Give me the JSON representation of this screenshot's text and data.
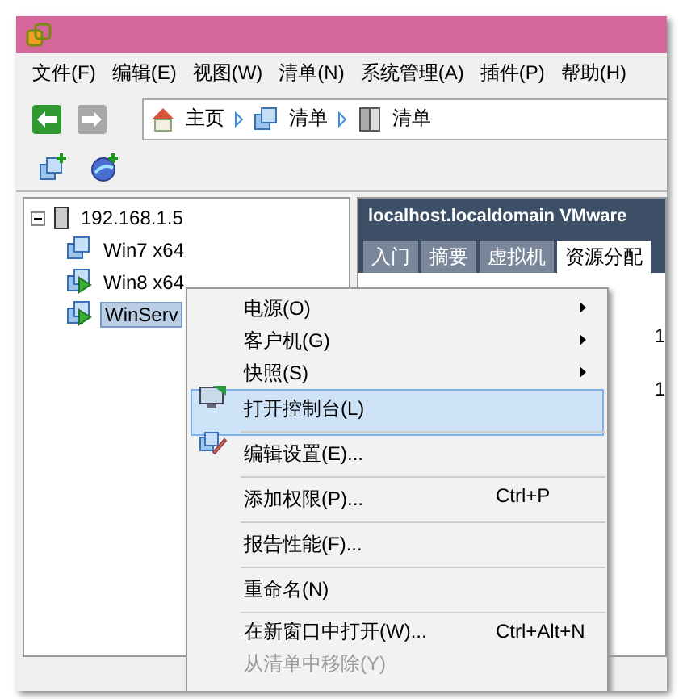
{
  "menu_bar": [
    "文件(F)",
    "编辑(E)",
    "视图(W)",
    "清单(N)",
    "系统管理(A)",
    "插件(P)",
    "帮助(H)"
  ],
  "navigation": {
    "back_disabled": false,
    "forward_disabled": true,
    "breadcrumbs": [
      "主页",
      "清单",
      "清单"
    ]
  },
  "tree": {
    "label": "192.168.1.5",
    "expanded": true,
    "children": [
      {
        "label": "Win7 x64",
        "powered_on": false,
        "selected": false
      },
      {
        "label": "Win8 x64",
        "powered_on": true,
        "selected": false
      },
      {
        "label": "WinServ",
        "powered_on": true,
        "selected": true
      }
    ]
  },
  "detail": {
    "title": "localhost.localdomain VMware",
    "tabs": [
      {
        "label": "入门",
        "selected": false
      },
      {
        "label": "摘要",
        "selected": false
      },
      {
        "label": "虚拟机",
        "selected": false
      },
      {
        "label": "资源分配",
        "selected": true
      }
    ],
    "values": [
      "1",
      "1"
    ]
  },
  "context_menu": [
    {
      "label": "电源(O)",
      "submenu": true,
      "selected": false,
      "disabled": false,
      "separator_after": false
    },
    {
      "label": "客户机(G)",
      "submenu": true,
      "selected": false,
      "disabled": false,
      "separator_after": false
    },
    {
      "label": "快照(S)",
      "submenu": true,
      "selected": false,
      "disabled": false,
      "separator_after": false
    },
    {
      "label": "打开控制台(L)",
      "submenu": false,
      "selected": true,
      "disabled": false,
      "separator_after": true
    },
    {
      "label": "编辑设置(E)...",
      "submenu": false,
      "selected": false,
      "disabled": false,
      "separator_after": true
    },
    {
      "label": "添加权限(P)...",
      "shortcut": "Ctrl+P",
      "submenu": false,
      "selected": false,
      "disabled": false,
      "separator_after": true
    },
    {
      "label": "报告性能(F)...",
      "submenu": false,
      "selected": false,
      "disabled": false,
      "separator_after": true
    },
    {
      "label": "重命名(N)",
      "submenu": false,
      "selected": false,
      "disabled": false,
      "separator_after": true
    },
    {
      "label": "在新窗口中打开(W)...",
      "shortcut": "Ctrl+Alt+N",
      "submenu": false,
      "selected": false,
      "disabled": false,
      "separator_after": false
    },
    {
      "label": "从清单中移除(Y)",
      "submenu": false,
      "selected": false,
      "disabled": true,
      "separator_after": false
    }
  ]
}
